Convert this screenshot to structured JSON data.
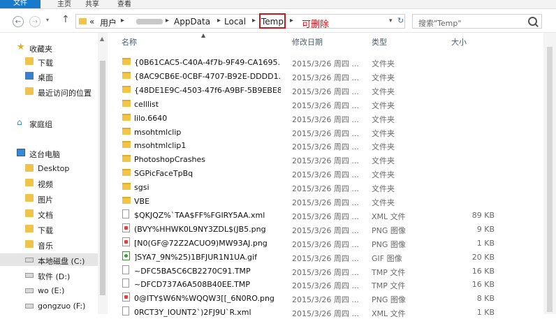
{
  "ribbon": {
    "file": "文件",
    "home": "主页",
    "share": "共享",
    "view": "查看"
  },
  "address": {
    "prefix": "«",
    "crumbs": [
      "用户",
      "AppData",
      "Local",
      "Temp"
    ],
    "annotation": "可删除"
  },
  "search": {
    "placeholder": "搜索\"Temp\""
  },
  "columns": {
    "name": "名称",
    "date": "修改日期",
    "type": "类型",
    "size": "大小"
  },
  "sidebar": {
    "favorites": "收藏夹",
    "fav_items": [
      "下载",
      "桌面",
      "最近访问的位置"
    ],
    "homegroup": "家庭组",
    "thispc": "这台电脑",
    "pc_items": [
      "Desktop",
      "视频",
      "图片",
      "文档",
      "下载",
      "音乐"
    ],
    "drives": [
      "本地磁盘 (C:)",
      "软件 (D:)",
      "wo (E:)",
      "gongzuo (F:)"
    ]
  },
  "files": [
    {
      "name": "{0B61CAC5-C40A-4f7b-9F49-CA1695...",
      "date": "2015/3/26 周四 ...",
      "type": "文件夹",
      "size": "",
      "kind": "folder"
    },
    {
      "name": "{8AC9CB6E-0CBF-4707-B92E-DDDD1...",
      "date": "2015/3/26 周四 ...",
      "type": "文件夹",
      "size": "",
      "kind": "folder"
    },
    {
      "name": "{48DE1E9C-4503-47f6-A9BF-5B9EBE8...",
      "date": "2015/3/26 周四 ...",
      "type": "文件夹",
      "size": "",
      "kind": "folder"
    },
    {
      "name": "celllist",
      "date": "2015/3/26 周四 ...",
      "type": "文件夹",
      "size": "",
      "kind": "folder"
    },
    {
      "name": "lilo.6640",
      "date": "2015/3/26 周四 ...",
      "type": "文件夹",
      "size": "",
      "kind": "folder"
    },
    {
      "name": "msohtmlclip",
      "date": "2015/3/26 周四 ...",
      "type": "文件夹",
      "size": "",
      "kind": "folder"
    },
    {
      "name": "msohtmlclip1",
      "date": "2015/3/26 周四 ...",
      "type": "文件夹",
      "size": "",
      "kind": "folder"
    },
    {
      "name": "PhotoshopCrashes",
      "date": "2015/3/26 周四 ...",
      "type": "文件夹",
      "size": "",
      "kind": "folder"
    },
    {
      "name": "SGPicFaceTpBq",
      "date": "2015/3/26 周四 ...",
      "type": "文件夹",
      "size": "",
      "kind": "folder"
    },
    {
      "name": "sgsi",
      "date": "2015/3/26 周四 ...",
      "type": "文件夹",
      "size": "",
      "kind": "folder"
    },
    {
      "name": "VBE",
      "date": "2015/3/26 周四 ...",
      "type": "文件夹",
      "size": "",
      "kind": "folder"
    },
    {
      "name": "$QKJQZ%`TAA$FF%FGIRY5AA.xml",
      "date": "2015/3/26 周四 ...",
      "type": "XML 文件",
      "size": "89 KB",
      "kind": "doc"
    },
    {
      "name": "(BVY%HHWK0L9NY3ZDL$(JB5.png",
      "date": "2015/3/26 周四 ...",
      "type": "PNG 图像",
      "size": "9 KB",
      "kind": "img"
    },
    {
      "name": "[N0(GF@72Z2ACUO9)MW93AJ.png",
      "date": "2015/3/26 周四 ...",
      "type": "PNG 图像",
      "size": "1 KB",
      "kind": "img"
    },
    {
      "name": "]SYA7_9N%25)1BFJUR1N1UA.gif",
      "date": "2015/3/26 周四 ...",
      "type": "GIF 图像",
      "size": "20 KB",
      "kind": "gif"
    },
    {
      "name": "~DFC5BA5C6CB2270C91.TMP",
      "date": "2015/3/26 周四 ...",
      "type": "TMP 文件",
      "size": "16 KB",
      "kind": "doc"
    },
    {
      "name": "~DFCD737A6A508B40EE.TMP",
      "date": "2015/3/26 周四 ...",
      "type": "TMP 文件",
      "size": "16 KB",
      "kind": "doc"
    },
    {
      "name": "0@ITY$W6N%WQQW3[[_6N0RO.png",
      "date": "2015/3/26 周四 ...",
      "type": "PNG 图像",
      "size": "8 KB",
      "kind": "img"
    },
    {
      "name": "0RCT3Y_IOUNT2`)2FJ9U`R.xml",
      "date": "2015/3/26 周四 ...",
      "type": "XML 文件",
      "size": "1 KB",
      "kind": "doc"
    }
  ]
}
